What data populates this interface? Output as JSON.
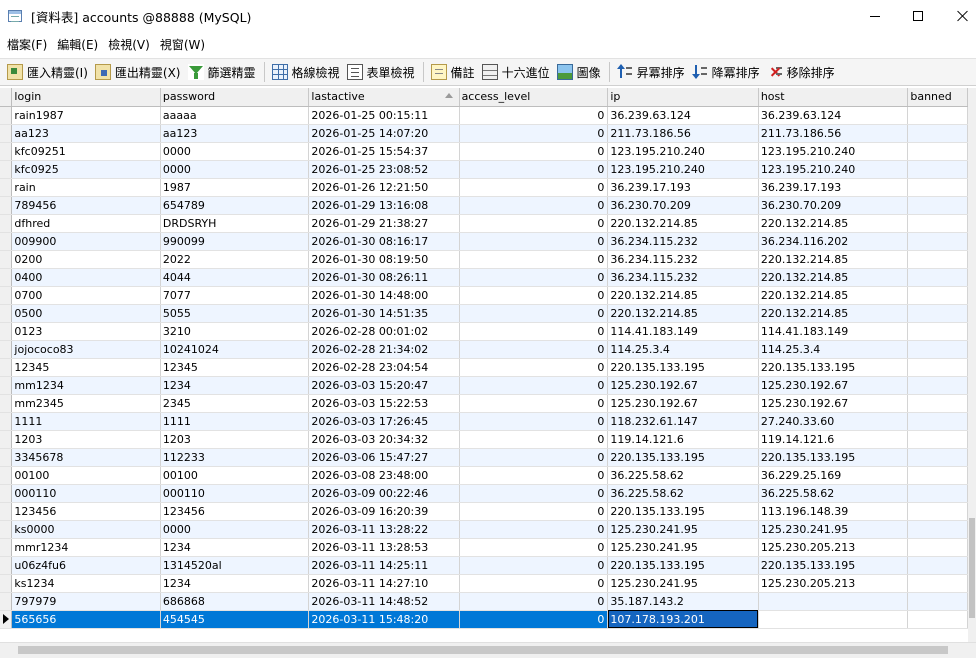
{
  "window": {
    "title": "[資料表] accounts @88888 (MySQL)"
  },
  "menu": [
    "檔案(F)",
    "編輯(E)",
    "檢視(V)",
    "視窗(W)"
  ],
  "toolbar": [
    {
      "label": "匯入精靈(I)",
      "icon": "import-wizard-icon"
    },
    {
      "label": "匯出精靈(X)",
      "icon": "export-wizard-icon"
    },
    {
      "label": "篩選精靈",
      "icon": "filter-wizard-icon"
    },
    {
      "label": "格線檢視",
      "icon": "grid-view-icon"
    },
    {
      "label": "表單檢視",
      "icon": "form-view-icon"
    },
    {
      "label": "備註",
      "icon": "memo-icon"
    },
    {
      "label": "十六進位",
      "icon": "hex-icon"
    },
    {
      "label": "圖像",
      "icon": "image-icon"
    },
    {
      "label": "昇冪排序",
      "icon": "sort-ascending-icon"
    },
    {
      "label": "降冪排序",
      "icon": "sort-descending-icon"
    },
    {
      "label": "移除排序",
      "icon": "remove-sort-icon"
    }
  ],
  "grid": {
    "columns": [
      "login",
      "password",
      "lastactive",
      "access_level",
      "ip",
      "host",
      "banned"
    ],
    "sorted_column": "lastactive",
    "sort_direction": "ascending",
    "rows": [
      [
        "rain1987",
        "aaaaa",
        "2026-01-25 00:15:11",
        "0",
        "36.239.63.124",
        "36.239.63.124",
        ""
      ],
      [
        "aa123",
        "aa123",
        "2026-01-25 14:07:20",
        "0",
        "211.73.186.56",
        "211.73.186.56",
        ""
      ],
      [
        "kfc09251",
        "0000",
        "2026-01-25 15:54:37",
        "0",
        "123.195.210.240",
        "123.195.210.240",
        ""
      ],
      [
        "kfc0925",
        "0000",
        "2026-01-25 23:08:52",
        "0",
        "123.195.210.240",
        "123.195.210.240",
        ""
      ],
      [
        "rain",
        "1987",
        "2026-01-26 12:21:50",
        "0",
        "36.239.17.193",
        "36.239.17.193",
        ""
      ],
      [
        "789456",
        "654789",
        "2026-01-29 13:16:08",
        "0",
        "36.230.70.209",
        "36.230.70.209",
        ""
      ],
      [
        "dfhred",
        "DRDSRYH",
        "2026-01-29 21:38:27",
        "0",
        "220.132.214.85",
        "220.132.214.85",
        ""
      ],
      [
        "009900",
        "990099",
        "2026-01-30 08:16:17",
        "0",
        "36.234.115.232",
        "36.234.116.202",
        ""
      ],
      [
        "0200",
        "2022",
        "2026-01-30 08:19:50",
        "0",
        "36.234.115.232",
        "220.132.214.85",
        ""
      ],
      [
        "0400",
        "4044",
        "2026-01-30 08:26:11",
        "0",
        "36.234.115.232",
        "220.132.214.85",
        ""
      ],
      [
        "0700",
        "7077",
        "2026-01-30 14:48:00",
        "0",
        "220.132.214.85",
        "220.132.214.85",
        ""
      ],
      [
        "0500",
        "5055",
        "2026-01-30 14:51:35",
        "0",
        "220.132.214.85",
        "220.132.214.85",
        ""
      ],
      [
        "0123",
        "3210",
        "2026-02-28 00:01:02",
        "0",
        "114.41.183.149",
        "114.41.183.149",
        ""
      ],
      [
        "jojococo83",
        "10241024",
        "2026-02-28 21:34:02",
        "0",
        "114.25.3.4",
        "114.25.3.4",
        ""
      ],
      [
        "12345",
        "12345",
        "2026-02-28 23:04:54",
        "0",
        "220.135.133.195",
        "220.135.133.195",
        ""
      ],
      [
        "mm1234",
        "1234",
        "2026-03-03 15:20:47",
        "0",
        "125.230.192.67",
        "125.230.192.67",
        ""
      ],
      [
        "mm2345",
        "2345",
        "2026-03-03 15:22:53",
        "0",
        "125.230.192.67",
        "125.230.192.67",
        ""
      ],
      [
        "1111",
        "1111",
        "2026-03-03 17:26:45",
        "0",
        "118.232.61.147",
        "27.240.33.60",
        ""
      ],
      [
        "1203",
        "1203",
        "2026-03-03 20:34:32",
        "0",
        "119.14.121.6",
        "119.14.121.6",
        ""
      ],
      [
        "3345678",
        "112233",
        "2026-03-06 15:47:27",
        "0",
        "220.135.133.195",
        "220.135.133.195",
        ""
      ],
      [
        "00100",
        "00100",
        "2026-03-08 23:48:00",
        "0",
        "36.225.58.62",
        "36.229.25.169",
        ""
      ],
      [
        "000110",
        "000110",
        "2026-03-09 00:22:46",
        "0",
        "36.225.58.62",
        "36.225.58.62",
        ""
      ],
      [
        "123456",
        "123456",
        "2026-03-09 16:20:39",
        "0",
        "220.135.133.195",
        "113.196.148.39",
        ""
      ],
      [
        "ks0000",
        "0000",
        "2026-03-11 13:28:22",
        "0",
        "125.230.241.95",
        "125.230.241.95",
        ""
      ],
      [
        "mmr1234",
        "1234",
        "2026-03-11 13:28:53",
        "0",
        "125.230.241.95",
        "125.230.205.213",
        ""
      ],
      [
        "u06z4fu6",
        "1314520al",
        "2026-03-11 14:25:11",
        "0",
        "220.135.133.195",
        "220.135.133.195",
        ""
      ],
      [
        "ks1234",
        "1234",
        "2026-03-11 14:27:10",
        "0",
        "125.230.241.95",
        "125.230.205.213",
        ""
      ],
      [
        "797979",
        "686868",
        "2026-03-11 14:48:52",
        "0",
        "35.187.143.2",
        "",
        ""
      ],
      [
        "565656",
        "454545",
        "2026-03-11 15:48:20",
        "0",
        "107.178.193.201",
        "",
        ""
      ]
    ]
  },
  "colors": {
    "selection": "#0078d7",
    "alt_row": "#eef5ff"
  }
}
